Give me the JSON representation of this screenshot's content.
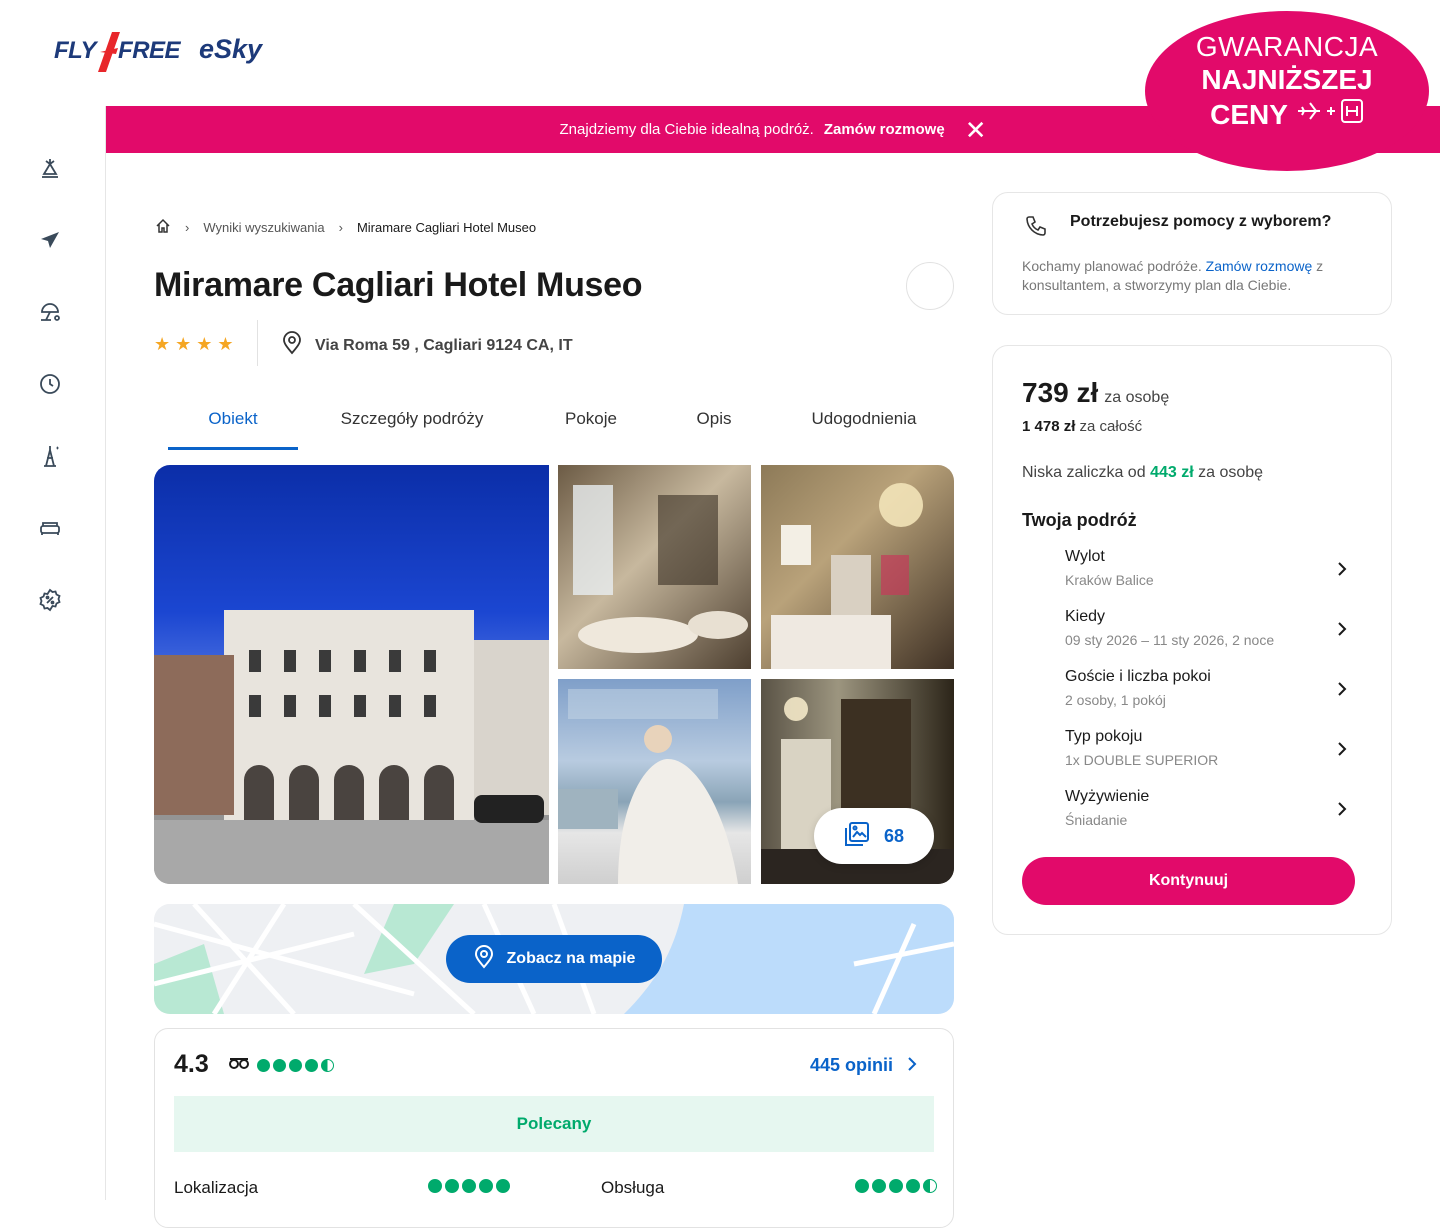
{
  "header": {
    "logo_flyfree_left": "FLY",
    "logo_flyfree_right": "FREE",
    "logo_esky": "eSky",
    "promo": {
      "text": "Znajdziemy dla Ciebie idealną podróż.",
      "link": "Zamów rozmowę",
      "close": "✕"
    },
    "badge": {
      "line1": "GWARANCJA",
      "line2": "NAJNIŻSZEJ",
      "line3": "CENY",
      "line3_icons": "✈+H"
    }
  },
  "sidebar": {
    "items": [
      {
        "icon": "package-holiday-icon"
      },
      {
        "icon": "flight-icon"
      },
      {
        "icon": "beach-icon"
      },
      {
        "icon": "last-minute-clock-icon"
      },
      {
        "icon": "city-break-icon"
      },
      {
        "icon": "hotel-bed-icon"
      },
      {
        "icon": "deals-percent-icon"
      }
    ]
  },
  "breadcrumb": {
    "home_icon": "home-icon",
    "items": [
      "Wyniki wyszukiwania",
      "Miramare Cagliari Hotel Museo"
    ]
  },
  "hotel": {
    "name": "Miramare Cagliari Hotel Museo",
    "stars": "★★★★",
    "address": "Via Roma 59 , Cagliari 9124 CA, IT"
  },
  "tabs": [
    "Obiekt",
    "Szczegóły podróży",
    "Pokoje",
    "Opis",
    "Udogodnienia"
  ],
  "gallery": {
    "count": "68"
  },
  "map": {
    "button": "Zobacz na mapie"
  },
  "reviews": {
    "rating": "4.3",
    "count_label": "445 opinii",
    "badge": "Polecany",
    "scores": [
      {
        "label": "Lokalizacja"
      },
      {
        "label": "Obsługa"
      }
    ]
  },
  "help": {
    "title": "Potrzebujesz pomocy z wyborem?",
    "text_before": "Kochamy planować podróże.",
    "link": "Zamów rozmowę",
    "text_after": "z konsultantem, a stworzymy plan dla Ciebie."
  },
  "booking": {
    "price": "739 zł",
    "per_person": "za osobę",
    "total": "1 478 zł",
    "total_suffix": "za całość",
    "deposit_prefix": "Niska zaliczka od",
    "deposit_amount": "443 zł",
    "deposit_suffix": "za osobę",
    "trip_title": "Twoja podróż",
    "trip": [
      {
        "label": "Wylot",
        "value": "Kraków Balice"
      },
      {
        "label": "Kiedy",
        "value": "09 sty 2026 – 11 sty 2026, 2 noce"
      },
      {
        "label": "Goście i liczba pokoi",
        "value": "2 osoby, 1 pokój"
      },
      {
        "label": "Typ pokoju",
        "value": "1x DOUBLE SUPERIOR"
      },
      {
        "label": "Wyżywienie",
        "value": "Śniadanie"
      }
    ],
    "continue": "Kontynuuj"
  },
  "colors": {
    "brand_pink": "#e20a6a",
    "brand_blue": "#0a63c9",
    "tripadvisor_green": "#00aa6c"
  }
}
